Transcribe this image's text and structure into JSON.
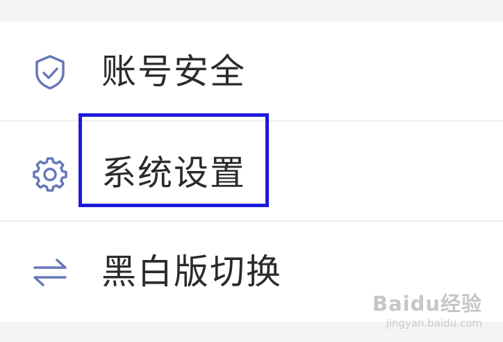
{
  "menu": {
    "items": [
      {
        "label": "账号安全",
        "icon": "shield-check-icon"
      },
      {
        "label": "系统设置",
        "icon": "gear-icon",
        "highlighted": true
      },
      {
        "label": "黑白版切换",
        "icon": "swap-arrows-icon"
      }
    ]
  },
  "colors": {
    "icon": "#6677b8",
    "highlight_border": "#1d19dc",
    "text": "#2b2b2b",
    "background": "#f4f4f6"
  },
  "watermark": {
    "brand": "Baidu经验",
    "url": "jingyan.baidu.com"
  }
}
